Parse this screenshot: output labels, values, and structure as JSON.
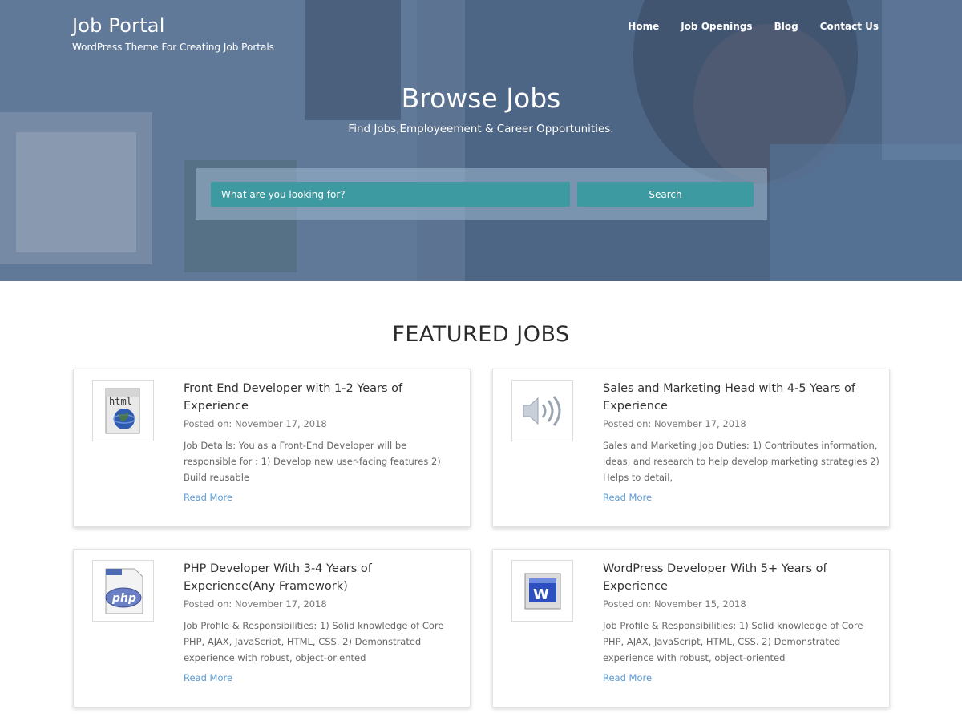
{
  "site": {
    "title": "Job Portal",
    "tagline": "WordPress Theme For Creating Job Portals"
  },
  "nav": {
    "items": [
      {
        "label": "Home"
      },
      {
        "label": "Job Openings"
      },
      {
        "label": "Blog"
      },
      {
        "label": "Contact Us"
      }
    ]
  },
  "hero": {
    "title": "Browse Jobs",
    "subtitle": "Find Jobs,Employeement & Career Opportunities."
  },
  "search": {
    "placeholder": "What are you looking for?",
    "button_label": "Search"
  },
  "featured": {
    "title": "FEATURED JOBS",
    "jobs": [
      {
        "icon": "html-globe-icon",
        "title": "Front End Developer with 1-2 Years of Experience",
        "date": "Posted on: November 17, 2018",
        "excerpt": "Job Details: You as a Front-End Developer will be responsible for : 1) Develop new user-facing features 2) Build reusable",
        "link": "Read More"
      },
      {
        "icon": "speaker-icon",
        "title": "Sales and Marketing Head with 4-5 Years of Experience",
        "date": "Posted on: November 17, 2018",
        "excerpt": "Sales and Marketing Job Duties: 1) Contributes information, ideas, and research to help develop marketing strategies 2) Helps to detail,",
        "link": "Read More"
      },
      {
        "icon": "php-file-icon",
        "title": "PHP Developer With 3-4 Years of Experience(Any Framework)",
        "date": "Posted on: November 17, 2018",
        "excerpt": "Job Profile & Responsibilities: 1) Solid knowledge of Core PHP, AJAX, JavaScript, HTML, CSS. 2) Demonstrated experience with robust, object-oriented",
        "link": "Read More"
      },
      {
        "icon": "wordpress-w-icon",
        "title": "WordPress Developer With 5+ Years of Experience",
        "date": "Posted on: November 15, 2018",
        "excerpt": "Job Profile & Responsibilities: 1) Solid knowledge of Core PHP, AJAX, JavaScript, HTML, CSS. 2) Demonstrated experience with robust, object-oriented",
        "link": "Read More"
      }
    ]
  },
  "colors": {
    "accent": "#3c9aa0",
    "link": "#5b9bd5",
    "hero_overlay": "#4a6688"
  }
}
